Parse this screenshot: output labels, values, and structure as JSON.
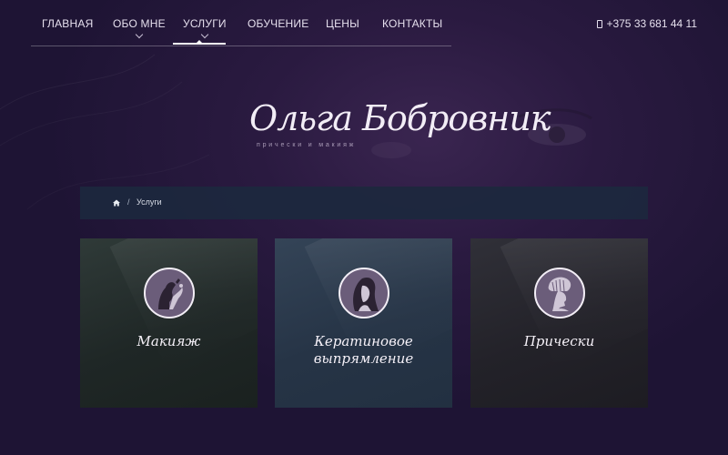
{
  "nav": {
    "items": [
      {
        "label": "ГЛАВНАЯ"
      },
      {
        "label": "ОБО МНЕ"
      },
      {
        "label": "УСЛУГИ"
      },
      {
        "label": "ОБУЧЕНИЕ"
      },
      {
        "label": "ЦЕНЫ"
      },
      {
        "label": "КОНТАКТЫ"
      }
    ],
    "active": "УСЛУГИ",
    "phone": "+375 33 681 44 11"
  },
  "logo": {
    "name": "Ольга Бобровник",
    "subtitle": "прически и макияж"
  },
  "breadcrumb": {
    "home_icon": "home-icon",
    "separator": "/",
    "current": "Услуги"
  },
  "cards": [
    {
      "title_line1": "Макияж",
      "title_line2": "",
      "icon": "makeup-hand-icon"
    },
    {
      "title_line1": "Кератиновое",
      "title_line2": "выпрямление",
      "icon": "long-hair-woman-icon"
    },
    {
      "title_line1": "Прически",
      "title_line2": "",
      "icon": "hairstyle-profile-icon"
    }
  ],
  "colors": {
    "background": "#2a1a40",
    "breadcrumb_bg": "#1c283e",
    "card_makeup": "#1f2726",
    "card_keratin": "#263446",
    "card_hairstyles": "#232229",
    "icon_circle": "#6b5d7a"
  }
}
